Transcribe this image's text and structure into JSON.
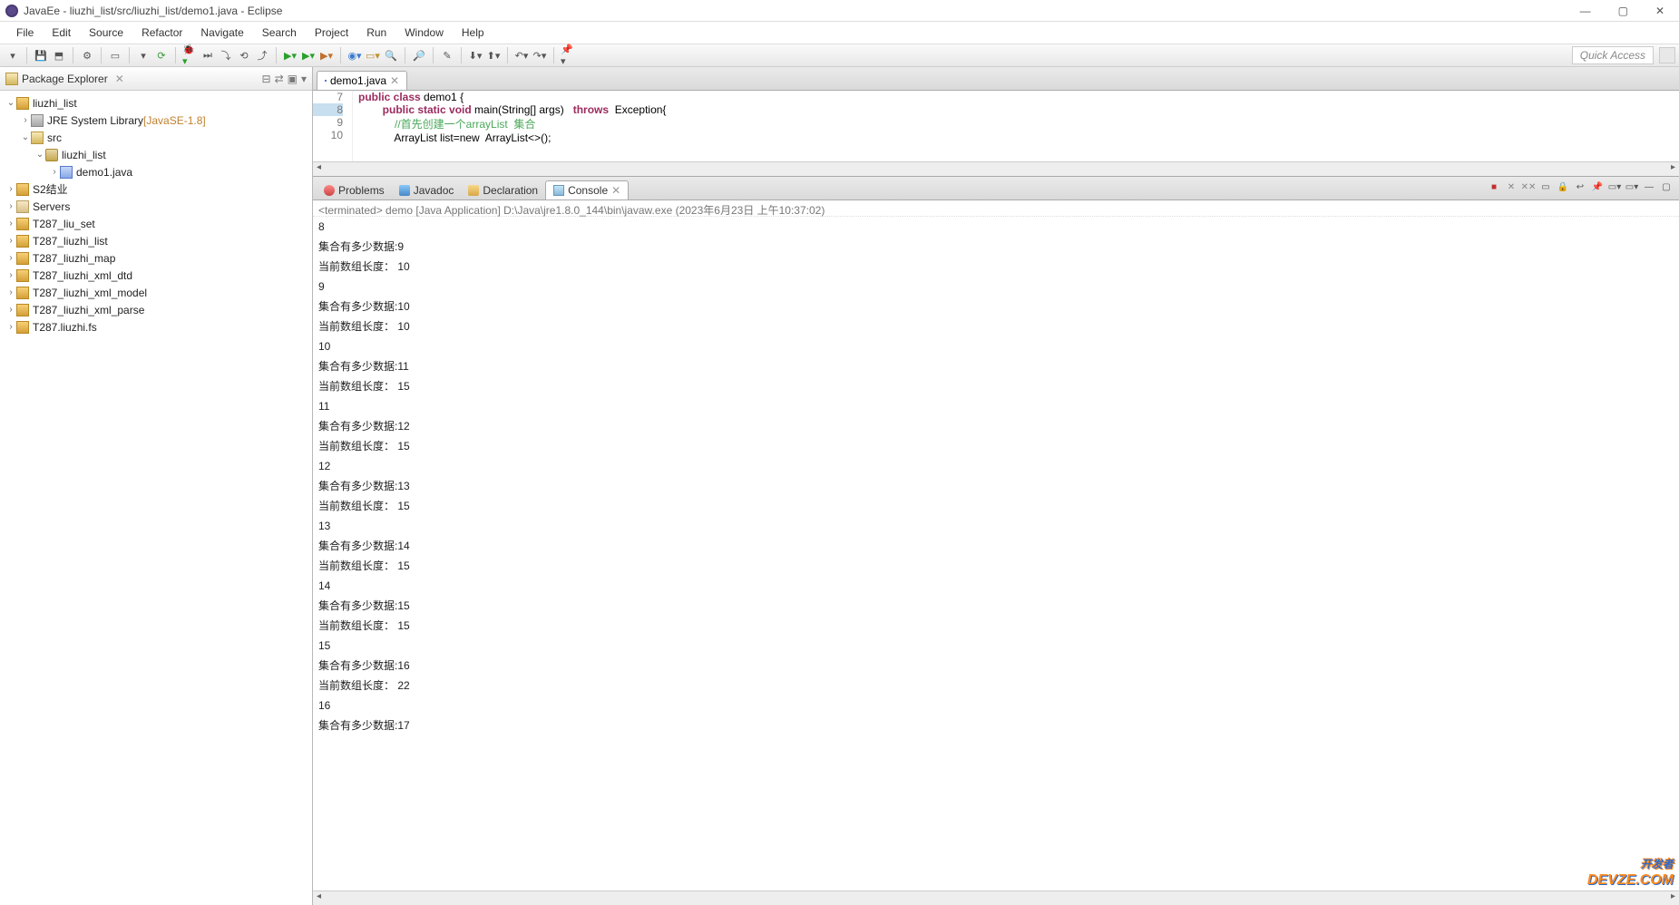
{
  "window": {
    "title": "JavaEe - liuzhi_list/src/liuzhi_list/demo1.java - Eclipse"
  },
  "menu": [
    "File",
    "Edit",
    "Source",
    "Refactor",
    "Navigate",
    "Search",
    "Project",
    "Run",
    "Window",
    "Help"
  ],
  "quick_access": "Quick Access",
  "package_explorer": {
    "title": "Package Explorer",
    "items": [
      {
        "indent": 0,
        "arrow": "v",
        "icon": "project",
        "label": "liuzhi_list"
      },
      {
        "indent": 1,
        "arrow": ">",
        "icon": "jre",
        "label": "JRE System Library ",
        "suffix": "[JavaSE-1.8]"
      },
      {
        "indent": 1,
        "arrow": "v",
        "icon": "src",
        "label": "src"
      },
      {
        "indent": 2,
        "arrow": "v",
        "icon": "pkg",
        "label": "liuzhi_list"
      },
      {
        "indent": 3,
        "arrow": ">",
        "icon": "java",
        "label": "demo1.java"
      },
      {
        "indent": 0,
        "arrow": ">",
        "icon": "project",
        "label": "S2结业"
      },
      {
        "indent": 0,
        "arrow": ">",
        "icon": "folder",
        "label": "Servers"
      },
      {
        "indent": 0,
        "arrow": ">",
        "icon": "project",
        "label": "T287_liu_set"
      },
      {
        "indent": 0,
        "arrow": ">",
        "icon": "project",
        "label": "T287_liuzhi_list"
      },
      {
        "indent": 0,
        "arrow": ">",
        "icon": "project",
        "label": "T287_liuzhi_map"
      },
      {
        "indent": 0,
        "arrow": ">",
        "icon": "project",
        "label": "T287_liuzhi_xml_dtd"
      },
      {
        "indent": 0,
        "arrow": ">",
        "icon": "project",
        "label": "T287_liuzhi_xml_model"
      },
      {
        "indent": 0,
        "arrow": ">",
        "icon": "project",
        "label": "T287_liuzhi_xml_parse"
      },
      {
        "indent": 0,
        "arrow": ">",
        "icon": "project",
        "label": "T287.liuzhi.fs"
      }
    ]
  },
  "editor": {
    "tab": "demo1.java",
    "gutter": [
      "7",
      "8",
      "9",
      "10"
    ],
    "highlight_index": 1,
    "lines": [
      {
        "indent": "",
        "tokens": [
          {
            "t": "public class",
            "c": "kw"
          },
          {
            "t": " demo1 {",
            "c": ""
          }
        ]
      },
      {
        "indent": "        ",
        "tokens": [
          {
            "t": "public static void",
            "c": "kw"
          },
          {
            "t": " main(String[] args)   ",
            "c": ""
          },
          {
            "t": "throws",
            "c": "kw"
          },
          {
            "t": "  Exception{",
            "c": ""
          }
        ]
      },
      {
        "indent": "            ",
        "tokens": [
          {
            "t": "//首先创建一个arrayList  集合",
            "c": "cmt"
          }
        ]
      },
      {
        "indent": "            ",
        "tokens": [
          {
            "t": "ArrayList list=new  ArrayList<>();",
            "c": ""
          }
        ]
      }
    ]
  },
  "bottom_tabs": [
    {
      "icon": "problems",
      "label": "Problems"
    },
    {
      "icon": "javadoc",
      "label": "Javadoc"
    },
    {
      "icon": "decl",
      "label": "Declaration"
    },
    {
      "icon": "console",
      "label": "Console",
      "active": true
    }
  ],
  "console": {
    "header": "<terminated> demo [Java Application] D:\\Java\\jre1.8.0_144\\bin\\javaw.exe (2023年6月23日 上午10:37:02)",
    "lines": [
      "8",
      "集合有多少数据:9",
      "当前数组长度： 10",
      "9",
      "集合有多少数据:10",
      "当前数组长度： 10",
      "10",
      "集合有多少数据:11",
      "当前数组长度： 15",
      "11",
      "集合有多少数据:12",
      "当前数组长度： 15",
      "12",
      "集合有多少数据:13",
      "当前数组长度： 15",
      "13",
      "集合有多少数据:14",
      "当前数组长度： 15",
      "14",
      "集合有多少数据:15",
      "当前数组长度： 15",
      "15",
      "集合有多少数据:16",
      "当前数组长度： 22",
      "16",
      "集合有多少数据:17"
    ]
  },
  "watermark": {
    "l1": "开发者",
    "l2": "DEVZE.COM"
  }
}
